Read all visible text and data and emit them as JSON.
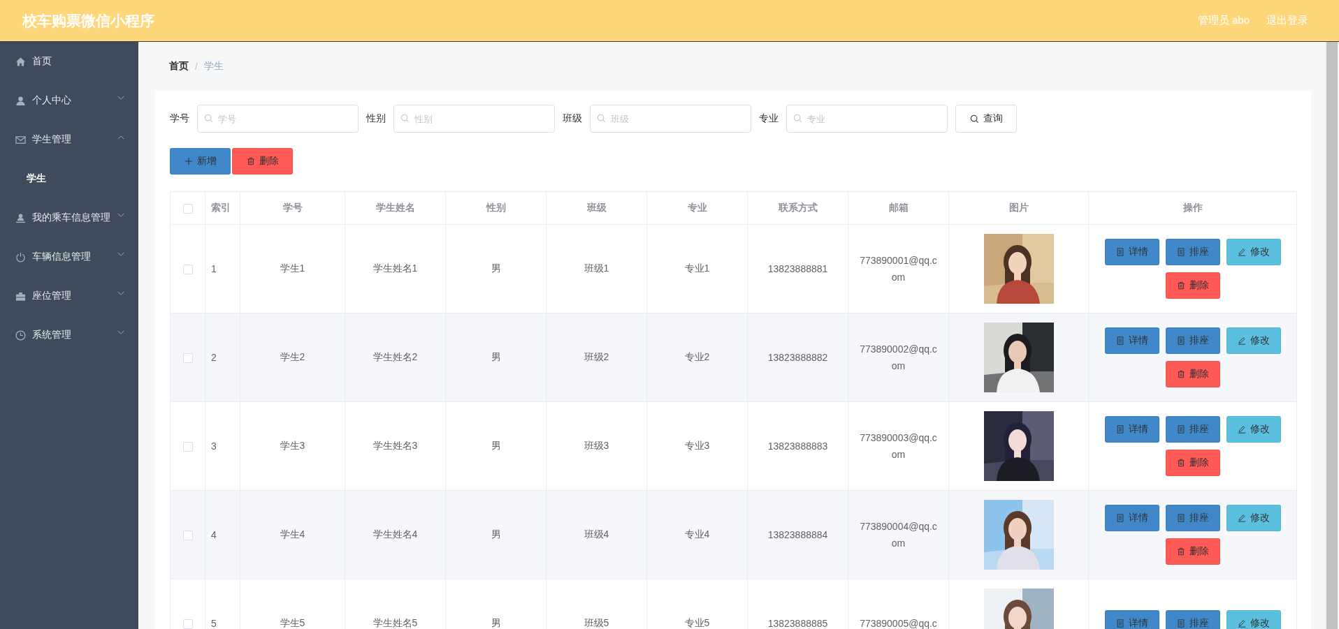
{
  "header": {
    "title": "校车购票微信小程序",
    "user": "管理员 abo",
    "logout": "退出登录"
  },
  "sidebar": {
    "items": [
      {
        "label": "首页"
      },
      {
        "label": "个人中心",
        "expanded": false
      },
      {
        "label": "学生管理",
        "expanded": true,
        "children": [
          {
            "label": "学生",
            "selected": true
          }
        ]
      },
      {
        "label": "我的乘车信息管理",
        "expanded": false
      },
      {
        "label": "车辆信息管理",
        "expanded": false
      },
      {
        "label": "座位管理",
        "expanded": false
      },
      {
        "label": "系统管理",
        "expanded": false
      }
    ]
  },
  "breadcrumb": {
    "separator": "/",
    "items": [
      {
        "label": "首页",
        "current": false
      },
      {
        "label": "学生",
        "current": true
      }
    ]
  },
  "filters": [
    {
      "label": "学号",
      "placeholder": "学号"
    },
    {
      "label": "性别",
      "placeholder": "性别"
    },
    {
      "label": "班级",
      "placeholder": "班级"
    },
    {
      "label": "专业",
      "placeholder": "专业"
    }
  ],
  "search_button": "查询",
  "toolbar": [
    {
      "label": "新增",
      "kind": "add"
    },
    {
      "label": "删除",
      "kind": "delete"
    }
  ],
  "table": {
    "columns": [
      "索引",
      "学号",
      "学生姓名",
      "性别",
      "班级",
      "专业",
      "联系方式",
      "邮箱",
      "图片",
      "操作"
    ],
    "all_checked": false,
    "rows": [
      {
        "checked": false,
        "index": "1",
        "student_no": "学生1",
        "name": "学生姓名1",
        "gender": "男",
        "class": "班级1",
        "major": "专业1",
        "phone": "13823888881",
        "email": "773890001@qq.com",
        "actions": [
          {
            "label": "详情",
            "kind": "detail"
          },
          {
            "label": "排座",
            "kind": "seat"
          },
          {
            "label": "修改",
            "kind": "edit"
          },
          {
            "label": "删除",
            "kind": "delete"
          }
        ]
      },
      {
        "checked": false,
        "index": "2",
        "student_no": "学生2",
        "name": "学生姓名2",
        "gender": "男",
        "class": "班级2",
        "major": "专业2",
        "phone": "13823888882",
        "email": "773890002@qq.com",
        "actions": [
          {
            "label": "详情",
            "kind": "detail"
          },
          {
            "label": "排座",
            "kind": "seat"
          },
          {
            "label": "修改",
            "kind": "edit"
          },
          {
            "label": "删除",
            "kind": "delete"
          }
        ]
      },
      {
        "checked": false,
        "index": "3",
        "student_no": "学生3",
        "name": "学生姓名3",
        "gender": "男",
        "class": "班级3",
        "major": "专业3",
        "phone": "13823888883",
        "email": "773890003@qq.com",
        "actions": [
          {
            "label": "详情",
            "kind": "detail"
          },
          {
            "label": "排座",
            "kind": "seat"
          },
          {
            "label": "修改",
            "kind": "edit"
          },
          {
            "label": "删除",
            "kind": "delete"
          }
        ]
      },
      {
        "checked": false,
        "index": "4",
        "student_no": "学生4",
        "name": "学生姓名4",
        "gender": "男",
        "class": "班级4",
        "major": "专业4",
        "phone": "13823888884",
        "email": "773890004@qq.com",
        "actions": [
          {
            "label": "详情",
            "kind": "detail"
          },
          {
            "label": "排座",
            "kind": "seat"
          },
          {
            "label": "修改",
            "kind": "edit"
          },
          {
            "label": "删除",
            "kind": "delete"
          }
        ]
      },
      {
        "checked": false,
        "index": "5",
        "student_no": "学生5",
        "name": "学生姓名5",
        "gender": "男",
        "class": "班级5",
        "major": "专业5",
        "phone": "13823888885",
        "email": "773890005@qq.c",
        "actions": [
          {
            "label": "详情",
            "kind": "detail"
          },
          {
            "label": "排座",
            "kind": "seat"
          },
          {
            "label": "修改",
            "kind": "edit"
          }
        ]
      }
    ]
  }
}
